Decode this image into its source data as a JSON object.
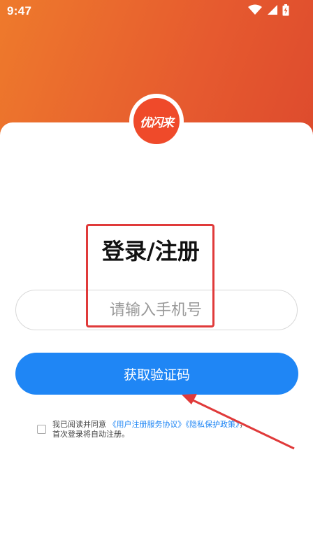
{
  "status_bar": {
    "time": "9:47",
    "icons": [
      "wifi-icon",
      "cellular-signal-icon",
      "battery-charging-icon"
    ]
  },
  "logo": {
    "text": "优闪来"
  },
  "login": {
    "title": "登录/注册",
    "phone_placeholder": "请输入手机号",
    "phone_value": "",
    "get_code_label": "获取验证码",
    "agreement": {
      "checked": false,
      "prefix": "我已阅读并同意 ",
      "user_agreement_link": "《用户注册服务协议》",
      "privacy_link": "《隐私保护政策》",
      "comma": "，",
      "suffix": "首次登录将自动注册。"
    }
  },
  "annotation": {
    "box_color": "#e03a3a",
    "arrow_color": "#e03a3a"
  },
  "colors": {
    "header_gradient_start": "#ee7a2c",
    "header_gradient_end": "#dd4a2d",
    "logo_bg": "#ef4a2a",
    "primary_button": "#1f86f5",
    "link": "#1f86f5"
  }
}
